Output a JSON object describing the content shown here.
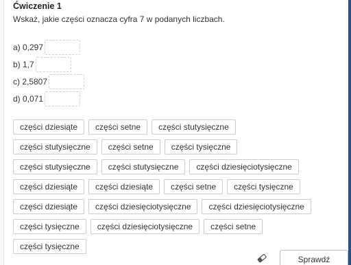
{
  "exercise": {
    "title": "Ćwiczenie 1",
    "instruction": "Wskaż, jakie części oznacza cyfra 7 w podanych liczbach."
  },
  "questions": [
    {
      "label": "a) 0,297"
    },
    {
      "label": "b) 1,7"
    },
    {
      "label": "c) 2,5807"
    },
    {
      "label": "d) 0,071"
    }
  ],
  "options": [
    "części dziesiąte",
    "części setne",
    "części stutysięczne",
    "części stutysięczne",
    "części setne",
    "części tysięczne",
    "części stutysięczne",
    "części stutysięczne",
    "części dziesięciotysięczne",
    "części dziesiąte",
    "części dziesiąte",
    "części setne",
    "części tysięczne",
    "części dziesiąte",
    "części dziesięciotysięczne",
    "części dziesięciotysięczne",
    "części tysięczne",
    "części dziesięciotysięczne",
    "części setne",
    "części tysięczne"
  ],
  "footer": {
    "check_label": "Sprawdź",
    "clear_icon": "eraser-icon"
  },
  "colors": {
    "accent_frame": "#2f4f7f",
    "chip_border": "#c7cdd3",
    "slot_border": "#c9d3de"
  }
}
